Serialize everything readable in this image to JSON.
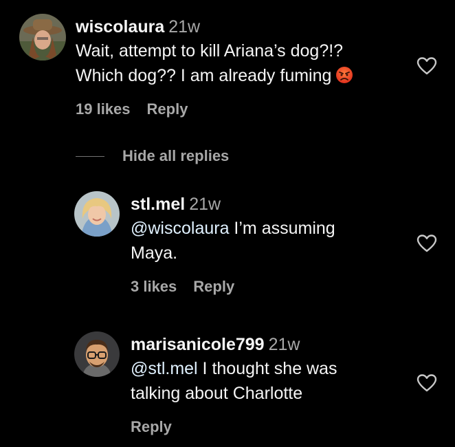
{
  "comments": [
    {
      "username": "wiscolaura",
      "time": "21w",
      "text_line1": "Wait, attempt to kill Ariana’s dog?!?",
      "text_line2": "Which dog?? I am already fuming",
      "emoji": "angry-face-icon",
      "likes": "19 likes",
      "reply": "Reply"
    },
    {
      "username": "stl.mel",
      "time": "21w",
      "mention": "@wiscolaura",
      "text_line1_rest": " I’m assuming",
      "text_line2": "Maya.",
      "likes": "3 likes",
      "reply": "Reply"
    },
    {
      "username": "marisanicole799",
      "time": "21w",
      "mention": "@stl.mel",
      "text_line1_rest": " I thought she was",
      "text_line2": "talking about Charlotte",
      "reply": "Reply"
    }
  ],
  "hide_replies": "Hide all replies",
  "colors": {
    "background": "#000000",
    "primary_text": "#f5f5f5",
    "secondary_text": "#a8a8a8",
    "mention": "#e0f1ff"
  }
}
